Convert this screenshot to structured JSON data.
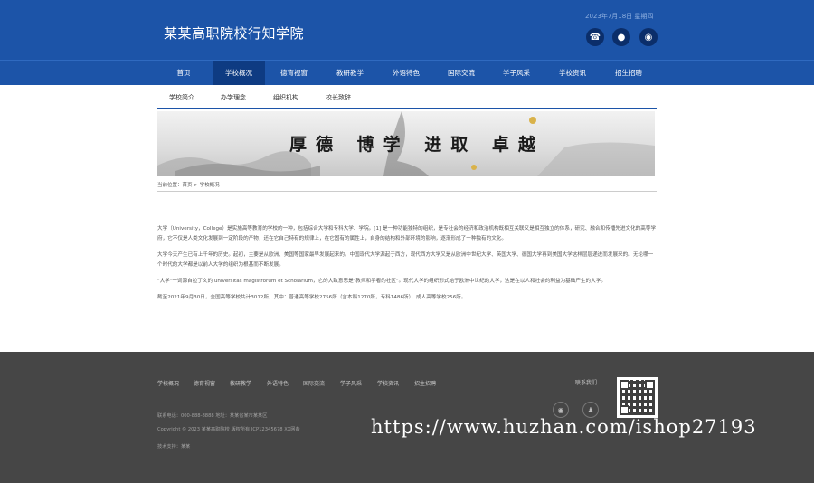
{
  "header": {
    "title": "某某高职院校行知学院",
    "date": "2023年7月18日  星期四",
    "icons": [
      "phone-icon",
      "wechat-icon",
      "weibo-icon"
    ]
  },
  "nav": {
    "items": [
      "首页",
      "学校概况",
      "德育视窗",
      "教研教学",
      "外语特色",
      "国际交流",
      "学子风采",
      "学校资讯",
      "招生招聘"
    ],
    "active_index": 1
  },
  "subnav": {
    "items": [
      "学校简介",
      "办学理念",
      "组织机构",
      "校长致辞"
    ]
  },
  "banner": {
    "text": "厚德 博学 进取 卓越"
  },
  "breadcrumb": "当前位置：首页 > 学校概况",
  "content": {
    "paragraphs": [
      "大学（University，College）是实施高等教育的学校的一种，包括综合大学和专科大学、学院。[1] 是一种功能独特的组织，是专社会的经济和政治机构既相互关联又是相互独立的体系，研究、融合和传播先进文化的高等学府，它不仅是人类文化发展到一定阶段的产物，还在它自己特有的规律上，在它固有的属性上，自身的结构和外部环境的影响，逐渐形成了一种独有的文化。",
      "大学今天产生已有上千年的历史。起初，主要是从欧洲、美国等国家最早发展起来的。中国现代大学源起于西方，现代西方大学又是从欧洲中世纪大学、英国大学、德国大学再到美国大学这样层层递进而发展来的。无论哪一个时代的大学都是以前人大学的组织为根基而不断发展。",
      "\"大学\"一词源自拉丁文的 universitas magistrorum et Scholarium，它的大致意思是\"教师和学者的社区\"。现代大学的组织形式始于欧洲中世纪的大学，这是在以人和社会的利益为基础产生的大学。",
      "截至2021年9月30日，全国高等学校共计3012所，其中：普通高等学校2756所（含本科1270所，专科1486所），成人高等学校256所。"
    ]
  },
  "footer": {
    "nav": [
      "学校概况",
      "德育视窗",
      "教研教学",
      "外语特色",
      "国际交流",
      "学子风采",
      "学校资讯",
      "招生招聘"
    ],
    "contact_label": "联系我们",
    "address": "联系电话：000-888-8888  地址：某某省某市某某区",
    "copyright": "Copyright © 2023 某某高职院校 版权所有  ICP12345678  XX网备",
    "tech": "技术支持：某某",
    "icons": [
      "weibo-icon",
      "qq-icon"
    ]
  },
  "watermark": "https://www.huzhan.com/ishop27193"
}
